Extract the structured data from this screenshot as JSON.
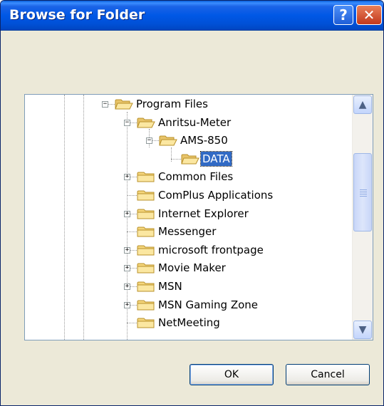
{
  "window": {
    "title": "Browse for Folder"
  },
  "controls": {
    "help": "?",
    "close": "✕"
  },
  "description": "",
  "tree": {
    "items": [
      {
        "label": "Program Files",
        "expander": "minus"
      },
      {
        "label": "Anritsu-Meter",
        "expander": "minus"
      },
      {
        "label": "AMS-850",
        "expander": "minus"
      },
      {
        "label": "DATA",
        "expander": "none",
        "selected": true,
        "icon": "open-folder-icon"
      },
      {
        "label": "Common Files",
        "expander": "plus"
      },
      {
        "label": "ComPlus Applications",
        "expander": "none"
      },
      {
        "label": "Internet Explorer",
        "expander": "plus"
      },
      {
        "label": "Messenger",
        "expander": "none"
      },
      {
        "label": "microsoft frontpage",
        "expander": "plus"
      },
      {
        "label": "Movie Maker",
        "expander": "plus"
      },
      {
        "label": "MSN",
        "expander": "plus"
      },
      {
        "label": "MSN Gaming Zone",
        "expander": "plus"
      },
      {
        "label": "NetMeeting",
        "expander": "none"
      }
    ]
  },
  "buttons": {
    "ok": "OK",
    "cancel": "Cancel"
  },
  "colors": {
    "titlebar": "#0058E6",
    "selection": "#316AC5",
    "dialog_bg": "#ECE9D8"
  }
}
